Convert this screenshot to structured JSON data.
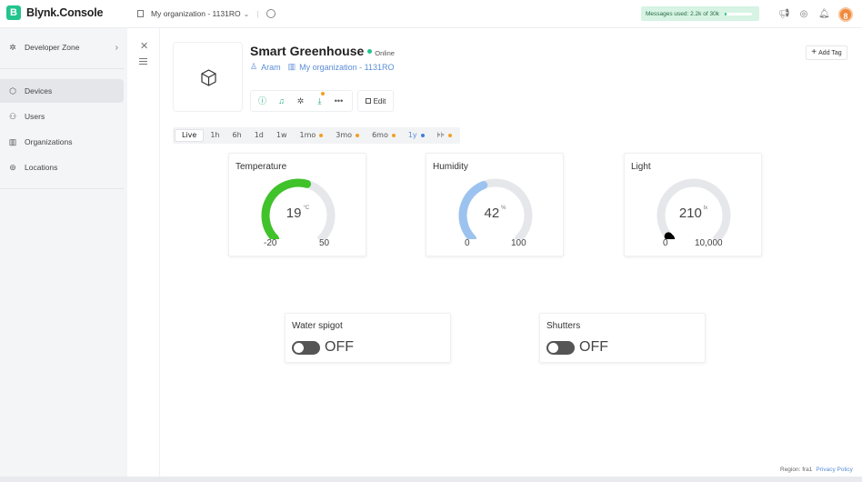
{
  "app": {
    "logo_letter": "B",
    "name": "Blynk.Console"
  },
  "org_switcher": {
    "label": "My organization - 1131RO"
  },
  "messages": {
    "label": "Messages used: 2.2k of 30k",
    "used_fraction": 0.07,
    "color": "#23c48e"
  },
  "top_icons": [
    "megaphone-icon",
    "help-icon",
    "bell-icon"
  ],
  "avatar": {
    "initial": "8",
    "color": "#f08a3c"
  },
  "sidebar": {
    "developer_zone": "Developer Zone",
    "items": [
      {
        "label": "Devices",
        "icon": "cube-icon",
        "active": true
      },
      {
        "label": "Users",
        "icon": "users-icon",
        "active": false
      },
      {
        "label": "Organizations",
        "icon": "organizations-icon",
        "active": false
      },
      {
        "label": "Locations",
        "icon": "location-pin-icon",
        "active": false
      }
    ]
  },
  "device": {
    "name": "Smart Greenhouse",
    "status": "Online",
    "owner": "Aram",
    "organization": "My organization - 1131RO",
    "edit_label": "Edit",
    "add_tag_label": "Add Tag"
  },
  "periods": [
    {
      "label": "Live",
      "active": true,
      "dot": ""
    },
    {
      "label": "1h",
      "active": false,
      "dot": ""
    },
    {
      "label": "6h",
      "active": false,
      "dot": ""
    },
    {
      "label": "1d",
      "active": false,
      "dot": ""
    },
    {
      "label": "1w",
      "active": false,
      "dot": ""
    },
    {
      "label": "1mo",
      "active": false,
      "dot": "#f0a020"
    },
    {
      "label": "3mo",
      "active": false,
      "dot": "#f0a020"
    },
    {
      "label": "6mo",
      "active": false,
      "dot": "#f0a020"
    },
    {
      "label": "1y",
      "active": false,
      "dot": "#3b7ddd"
    },
    {
      "label": "⊧⊧",
      "active": false,
      "dot": "#f0a020"
    }
  ],
  "gauges": [
    {
      "title": "Temperature",
      "value": "19",
      "unit": "°C",
      "min": "-20",
      "max": "50",
      "value_num": 19,
      "min_num": -20,
      "max_num": 50,
      "color": "#3fc22a"
    },
    {
      "title": "Humidity",
      "value": "42",
      "unit": "%",
      "min": "0",
      "max": "100",
      "value_num": 42,
      "min_num": 0,
      "max_num": 100,
      "color": "#9cc3ef"
    },
    {
      "title": "Light",
      "value": "210",
      "unit": "lx",
      "min": "0",
      "max": "10,000",
      "value_num": 210,
      "min_num": 0,
      "max_num": 10000,
      "color": "#000000"
    }
  ],
  "switches": [
    {
      "title": "Water spigot",
      "state": "OFF"
    },
    {
      "title": "Shutters",
      "state": "OFF"
    }
  ],
  "footer": {
    "region": "Region: fra1",
    "privacy": "Privacy Policy"
  }
}
